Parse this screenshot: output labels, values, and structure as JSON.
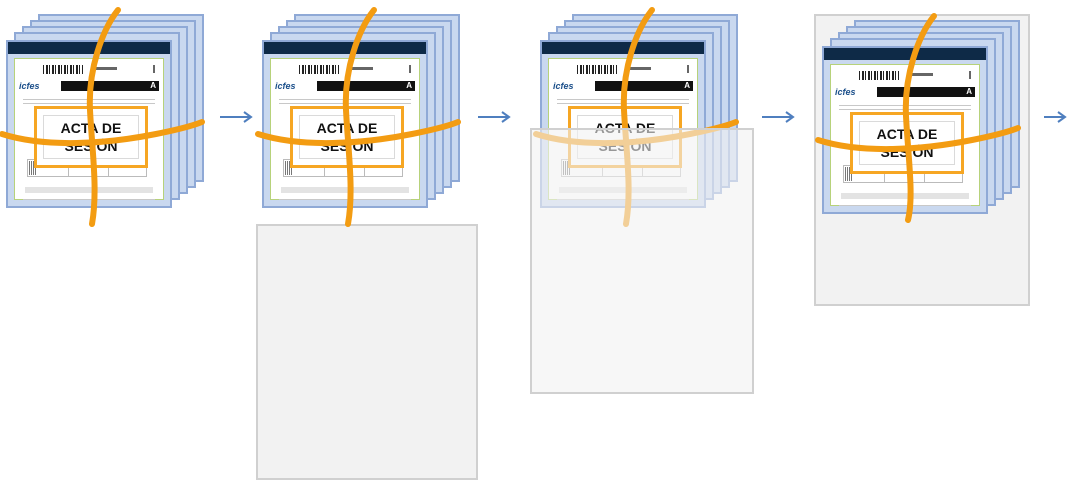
{
  "steps": [
    {
      "label": "ACTA DE SESIÓN",
      "letter": "A",
      "logo": "icfes"
    },
    {
      "label": "ACTA DE SESIÓN",
      "letter": "A",
      "logo": "icfes"
    },
    {
      "label": "ACTA DE SESIÓN",
      "letter": "A",
      "logo": "icfes"
    },
    {
      "label": "ACTA DE SESIÓN",
      "letter": "A",
      "logo": "icfes"
    }
  ],
  "colors": {
    "rope": "#f39c12",
    "sheet": "#c9d8ef",
    "sheet_border": "#8fa9d6",
    "header": "#0e2a47",
    "arrow": "#4f7fbf",
    "panel": "#f2f2f2"
  },
  "icons": [
    "bundle-icon",
    "arrow-right-icon",
    "barcode-icon",
    "logo-icon"
  ]
}
